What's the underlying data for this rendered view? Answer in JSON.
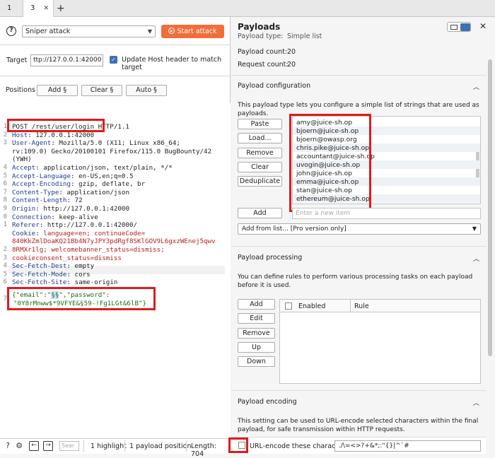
{
  "tabs": [
    {
      "label": "1"
    },
    {
      "label": "3",
      "close": "✕"
    }
  ],
  "new_tab": "+",
  "attack": {
    "type_value": "Sniper attack",
    "start_label": "Start attack"
  },
  "target": {
    "label": "Target",
    "value": "ttp://127.0.0.1:42000",
    "update_host_label": "Update Host header to match target",
    "update_host_checked": true
  },
  "positions": {
    "label": "Positions",
    "add": "Add §",
    "clear": "Clear §",
    "auto": "Auto §"
  },
  "request": {
    "line_numbers": [
      "1",
      "2",
      "3",
      "",
      "",
      "4",
      "5",
      "6",
      "7",
      "8",
      "9",
      "0",
      "1",
      "",
      "",
      "2",
      "3",
      "4",
      "5",
      "6",
      "",
      "7",
      ""
    ],
    "request_line": "POST /rest/user/login HTTP/1.1",
    "headers": [
      {
        "name": "Host",
        "value": "127.0.0.1:42000"
      },
      {
        "name": "User-Agent",
        "value": "Mozilla/5.0 (X11; Linux x86_64;"
      },
      {
        "name": "",
        "value": "rv:109.0) Gecko/20100101 Firefox/115.0 BugBounty/42"
      },
      {
        "name": "",
        "value": "(YWH)"
      },
      {
        "name": "Accept",
        "value": "application/json, text/plain, */*"
      },
      {
        "name": "Accept-Language",
        "value": "en-US,en;q=0.5"
      },
      {
        "name": "Accept-Encoding",
        "value": "gzip, deflate, br"
      },
      {
        "name": "Content-Type",
        "value": "application/json"
      },
      {
        "name": "Content-Length",
        "value": "72"
      },
      {
        "name": "Origin",
        "value": "http://127.0.0.1:42000"
      },
      {
        "name": "Connection",
        "value": "keep-alive"
      },
      {
        "name": "Referer",
        "value": "http://127.0.0.1:42000/"
      }
    ],
    "cookie_name": "Cookie",
    "cookie_lines": [
      "language=en; continueCode=",
      "840KkZmlDoaKQ21Bb4N7yJPY3pdRgf8SKlGOV9L6gxzWEnej5qwv",
      "8RMXr1lg; welcomebanner_status=dismiss;",
      "cookieconsent_status=dismiss"
    ],
    "sec_headers": [
      {
        "name": "Sec-Fetch-Dest",
        "value": "empty"
      },
      {
        "name": "Sec-Fetch-Mode",
        "value": "cors"
      },
      {
        "name": "Sec-Fetch-Site",
        "value": "same-origin"
      }
    ],
    "body_line1_pre": "{\"email\":\"",
    "body_marker": "§§",
    "body_line1_post": "\",\"password\":",
    "body_line2": "\"0Y8rMnww$*9VFYE&§59-!Fg1LGt&6lB\"}"
  },
  "status_bar": {
    "search_placeholder": "Sear",
    "highlights": "1 highlight",
    "payload_positions": "1 payload position",
    "length": "Length: 704"
  },
  "payloads_panel": {
    "title": "Payloads",
    "payload_type_label": "Payload type:",
    "payload_type_value": "Simple list",
    "payload_count_label": "Payload count:",
    "payload_count": "20",
    "request_count_label": "Request count:",
    "request_count": "20"
  },
  "payload_config": {
    "title": "Payload configuration",
    "description": "This payload type lets you configure a simple list of strings that are used as payloads.",
    "buttons": [
      "Paste",
      "Load...",
      "Remove",
      "Clear",
      "Deduplicate"
    ],
    "items": [
      "amy@juice-sh.op",
      "bjoern@juice-sh.op",
      "bjoern@owasp.org",
      "chris.pike@juice-sh.op",
      "accountant@juice-sh.op",
      "uvogin@juice-sh.op",
      "john@juice-sh.op",
      "emma@juice-sh.op",
      "stan@juice-sh.op",
      "ethereum@juice-sh.op"
    ],
    "add_label": "Add",
    "add_placeholder": "Enter a new item",
    "add_from_list": "Add from list... [Pro version only]"
  },
  "payload_processing": {
    "title": "Payload processing",
    "description": "You can define rules to perform various processing tasks on each payload before it is used.",
    "buttons": [
      "Add",
      "Edit",
      "Remove",
      "Up",
      "Down"
    ],
    "col_enabled": "Enabled",
    "col_rule": "Rule"
  },
  "payload_encoding": {
    "title": "Payload encoding",
    "description": "This setting can be used to URL-encode selected characters within the final payload, for safe transmission within HTTP requests.",
    "checkbox_label": "URL-encode these characters:",
    "chars": "./\\=<>?+&*;:\"{}|^`#"
  },
  "colors": {
    "accent_orange": "#f36d3a",
    "annotation_red": "#e01b1b",
    "checkbox_blue": "#3d6fb4"
  }
}
